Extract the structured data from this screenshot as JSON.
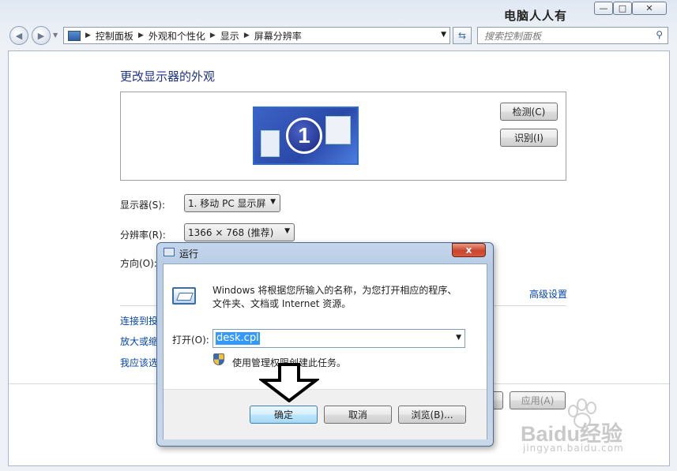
{
  "watermark_top": "电脑人人有",
  "window_controls": {
    "minimize": "—",
    "maximize": "□",
    "close": "✕"
  },
  "nav": {
    "back_icon": "back-arrow-icon",
    "forward_icon": "forward-arrow-icon",
    "breadcrumbs": [
      "控制面板",
      "外观和个性化",
      "显示",
      "屏幕分辨率"
    ],
    "search_placeholder": "搜索控制面板"
  },
  "main": {
    "title": "更改显示器的外观",
    "monitor_number": "1",
    "detect_button": "检测(C)",
    "identify_button": "识别(I)",
    "display_label": "显示器(S):",
    "display_value": "1. 移动 PC 显示屏",
    "resolution_label": "分辨率(R):",
    "resolution_value": "1366 × 768 (推荐)",
    "orientation_label": "方向(O):",
    "advanced_link": "高级设置",
    "links": [
      "连接到投",
      "放大或缩",
      "我应该选"
    ],
    "apply_button": "应用(A)"
  },
  "run_dialog": {
    "title": "运行",
    "close_label": "x",
    "description": "Windows 将根据您所输入的名称，为您打开相应的程序、文件夹、文档或 Internet 资源。",
    "open_label": "打开(O):",
    "input_value": "desk.cpl",
    "uac_text": "使用管理权限创建此任务。",
    "ok_button": "确定",
    "cancel_button": "取消",
    "browse_button": "浏览(B)..."
  },
  "watermark_bottom": "Baidu经验",
  "watermark_url": "jingyan.baidu.com",
  "colors": {
    "link": "#0645ad",
    "title": "#1e3287",
    "selection": "#3399ff",
    "close_red": "#c8452c"
  }
}
